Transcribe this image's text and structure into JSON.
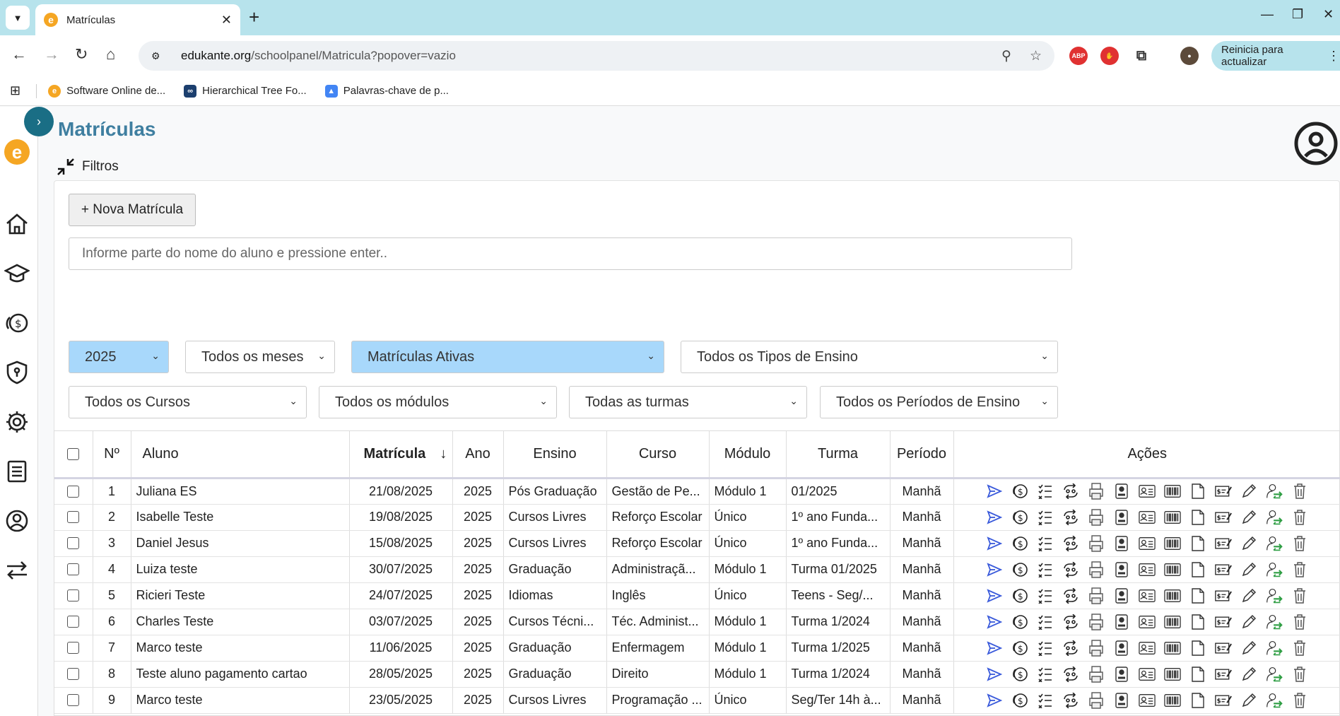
{
  "browser": {
    "tab_title": "Matrículas",
    "url_host": "edukante.org",
    "url_path": "/schoolpanel/Matricula?popover=vazio",
    "relaunch_label": "Reinicia para actualizar",
    "bookmarks": [
      "Software Online de...",
      "Hierarchical Tree Fo...",
      "Palavras-chave de p..."
    ]
  },
  "page": {
    "title": "Matrículas",
    "filters_label": "Filtros",
    "new_button": "+ Nova Matrícula",
    "search_placeholder": "Informe parte do nome do aluno e pressione enter.."
  },
  "filters": {
    "year": "2025",
    "months": "Todos os meses",
    "status": "Matrículas Ativas",
    "teaching_types": "Todos os Tipos de Ensino",
    "courses": "Todos os Cursos",
    "modules": "Todos os módulos",
    "classes": "Todas as turmas",
    "periods": "Todos os Períodos de Ensino"
  },
  "table": {
    "headers": [
      "Nº",
      "Aluno",
      "Matrícula",
      "Ano",
      "Ensino",
      "Curso",
      "Módulo",
      "Turma",
      "Período",
      "Ações"
    ],
    "sort_indicator": "↓",
    "rows": [
      {
        "n": "1",
        "aluno": "Juliana ES",
        "matricula": "21/08/2025",
        "ano": "2025",
        "ensino": "Pós Graduação",
        "curso": "Gestão de Pe...",
        "modulo": "Módulo 1",
        "turma": "01/2025",
        "periodo": "Manhã"
      },
      {
        "n": "2",
        "aluno": "Isabelle Teste",
        "matricula": "19/08/2025",
        "ano": "2025",
        "ensino": "Cursos Livres",
        "curso": "Reforço Escolar",
        "modulo": "Único",
        "turma": "1º ano Funda...",
        "periodo": "Manhã"
      },
      {
        "n": "3",
        "aluno": "Daniel Jesus",
        "matricula": "15/08/2025",
        "ano": "2025",
        "ensino": "Cursos Livres",
        "curso": "Reforço Escolar",
        "modulo": "Único",
        "turma": "1º ano Funda...",
        "periodo": "Manhã"
      },
      {
        "n": "4",
        "aluno": "Luiza teste",
        "matricula": "30/07/2025",
        "ano": "2025",
        "ensino": "Graduação",
        "curso": "Administraçã...",
        "modulo": "Módulo 1",
        "turma": "Turma 01/2025",
        "periodo": "Manhã"
      },
      {
        "n": "5",
        "aluno": "Ricieri Teste",
        "matricula": "24/07/2025",
        "ano": "2025",
        "ensino": "Idiomas",
        "curso": "Inglês",
        "modulo": "Único",
        "turma": "Teens - Seg/...",
        "periodo": "Manhã"
      },
      {
        "n": "6",
        "aluno": "Charles Teste",
        "matricula": "03/07/2025",
        "ano": "2025",
        "ensino": "Cursos Técni...",
        "curso": "Téc. Administ...",
        "modulo": "Módulo 1",
        "turma": "Turma 1/2024",
        "periodo": "Manhã"
      },
      {
        "n": "7",
        "aluno": "Marco teste",
        "matricula": "11/06/2025",
        "ano": "2025",
        "ensino": "Graduação",
        "curso": "Enfermagem",
        "modulo": "Módulo 1",
        "turma": "Turma 1/2025",
        "periodo": "Manhã"
      },
      {
        "n": "8",
        "aluno": "Teste aluno pagamento cartao",
        "matricula": "28/05/2025",
        "ano": "2025",
        "ensino": "Graduação",
        "curso": "Direito",
        "modulo": "Módulo 1",
        "turma": "Turma 1/2024",
        "periodo": "Manhã"
      },
      {
        "n": "9",
        "aluno": "Marco teste",
        "matricula": "23/05/2025",
        "ano": "2025",
        "ensino": "Cursos Livres",
        "curso": "Programação ...",
        "modulo": "Único",
        "turma": "Seg/Ter 14h à...",
        "periodo": "Manhã"
      }
    ],
    "action_icons": [
      "send-icon",
      "payment-icon",
      "checklist-icon",
      "sync-icon",
      "print-icon",
      "student-card-icon",
      "id-card-icon",
      "barcode-icon",
      "document-icon",
      "invoice-icon",
      "edit-icon",
      "transfer-user-icon",
      "trash-icon"
    ]
  },
  "colors": {
    "accent": "#3f7fa0",
    "brand_orange": "#f5a623",
    "active_select": "#a8d8fb",
    "chrome_tab": "#b7e3ec",
    "action_blue": "#3b5bdb",
    "action_green": "#2f9e44"
  }
}
